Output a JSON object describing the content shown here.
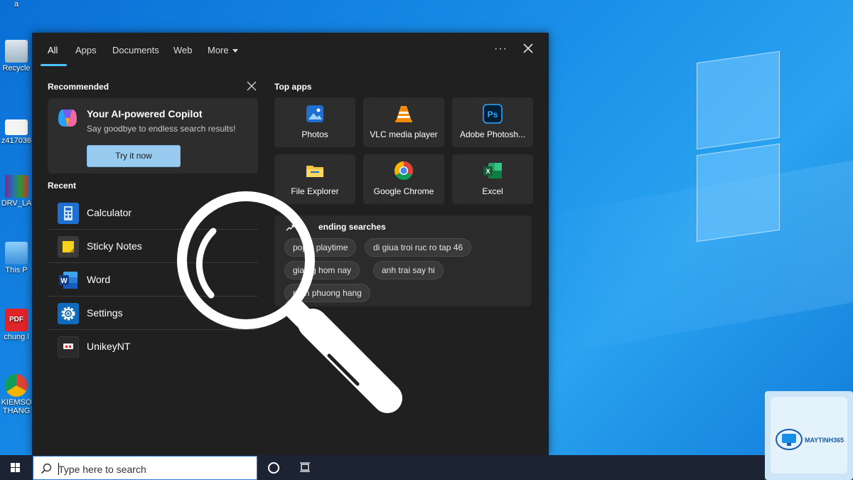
{
  "desktop": {
    "icons": [
      {
        "label": "a"
      },
      {
        "label": "Recycle"
      },
      {
        "label": "z417036"
      },
      {
        "label": "DRV_LA"
      },
      {
        "label": "This P"
      },
      {
        "label": "chung l"
      },
      {
        "label": "KIEMSO"
      },
      {
        "label": "THANG"
      }
    ]
  },
  "search_panel": {
    "tabs": [
      {
        "label": "All"
      },
      {
        "label": "Apps"
      },
      {
        "label": "Documents"
      },
      {
        "label": "Web"
      },
      {
        "label": "More"
      }
    ],
    "more_options_label": "···",
    "recommended": {
      "title": "Recommended",
      "card_title": "Your AI-powered Copilot",
      "card_subtitle": "Say goodbye to endless search results!",
      "button_label": "Try it now"
    },
    "recent": {
      "title": "Recent",
      "items": [
        {
          "label": "Calculator",
          "icon": "calculator-icon"
        },
        {
          "label": "Sticky Notes",
          "icon": "sticky-notes-icon"
        },
        {
          "label": "Word",
          "icon": "word-icon"
        },
        {
          "label": "Settings",
          "icon": "gear-icon"
        },
        {
          "label": "UnikeyNT",
          "icon": "unikey-icon"
        }
      ]
    },
    "top_apps": {
      "title": "Top apps",
      "items": [
        {
          "label": "Photos",
          "icon": "photos-icon"
        },
        {
          "label": "VLC media player",
          "icon": "vlc-icon"
        },
        {
          "label": "Adobe Photosh...",
          "icon": "photoshop-icon"
        },
        {
          "label": "File Explorer",
          "icon": "folder-icon"
        },
        {
          "label": "Google Chrome",
          "icon": "chrome-icon"
        },
        {
          "label": "Excel",
          "icon": "excel-icon"
        }
      ]
    },
    "trending": {
      "title": "ending searches",
      "chips": [
        {
          "label": "pop   y playtime"
        },
        {
          "label": "di giua troi ruc ro tap 46"
        },
        {
          "label": "gia   ng hom nay"
        },
        {
          "label": "anh trai say hi"
        },
        {
          "label": "n   en phuong hang"
        }
      ]
    }
  },
  "taskbar": {
    "search_placeholder": "Type here to search"
  },
  "watermark": {
    "brand": "MAYTINH365"
  },
  "colors": {
    "accent": "#4cc2ff",
    "panel_bg": "#202020",
    "tile_bg": "#2d2d2d",
    "button_bg": "#99cbf1",
    "taskbar_bg": "#1c2333"
  }
}
